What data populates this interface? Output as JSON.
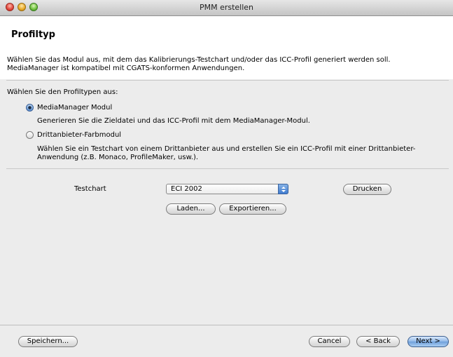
{
  "window": {
    "title": "PMM erstellen"
  },
  "header": {
    "heading": "Profiltyp",
    "description": "Wählen Sie das Modul aus, mit dem das Kalibrierungs-Testchart und/oder das ICC-Profil generiert werden soll. MediaManager ist kompatibel mit CGATS-konformen Anwendungen."
  },
  "profile_types": {
    "prompt": "Wählen Sie den Profiltypen aus:",
    "options": [
      {
        "label": "MediaManager Modul",
        "description": "Generieren Sie die Zieldatei und das ICC-Profil mit dem MediaManager-Modul.",
        "selected": true
      },
      {
        "label": "Drittanbieter-Farbmodul",
        "description": "Wählen Sie ein Testchart von einem Drittanbieter aus und erstellen Sie ein ICC-Profil mit einer Drittanbieter-Anwendung (z.B. Monaco, ProfileMaker, usw.).",
        "selected": false
      }
    ]
  },
  "testchart": {
    "label": "Testchart",
    "selected": "ECI 2002",
    "print_button": "Drucken",
    "load_button": "Laden...",
    "export_button": "Exportieren..."
  },
  "footer": {
    "save_button": "Speichern...",
    "cancel_button": "Cancel",
    "back_button": "< Back",
    "next_button": "Next >"
  },
  "colors": {
    "default_button": "#6fa0db",
    "content_background": "#ececec",
    "header_background": "#ffffff"
  }
}
